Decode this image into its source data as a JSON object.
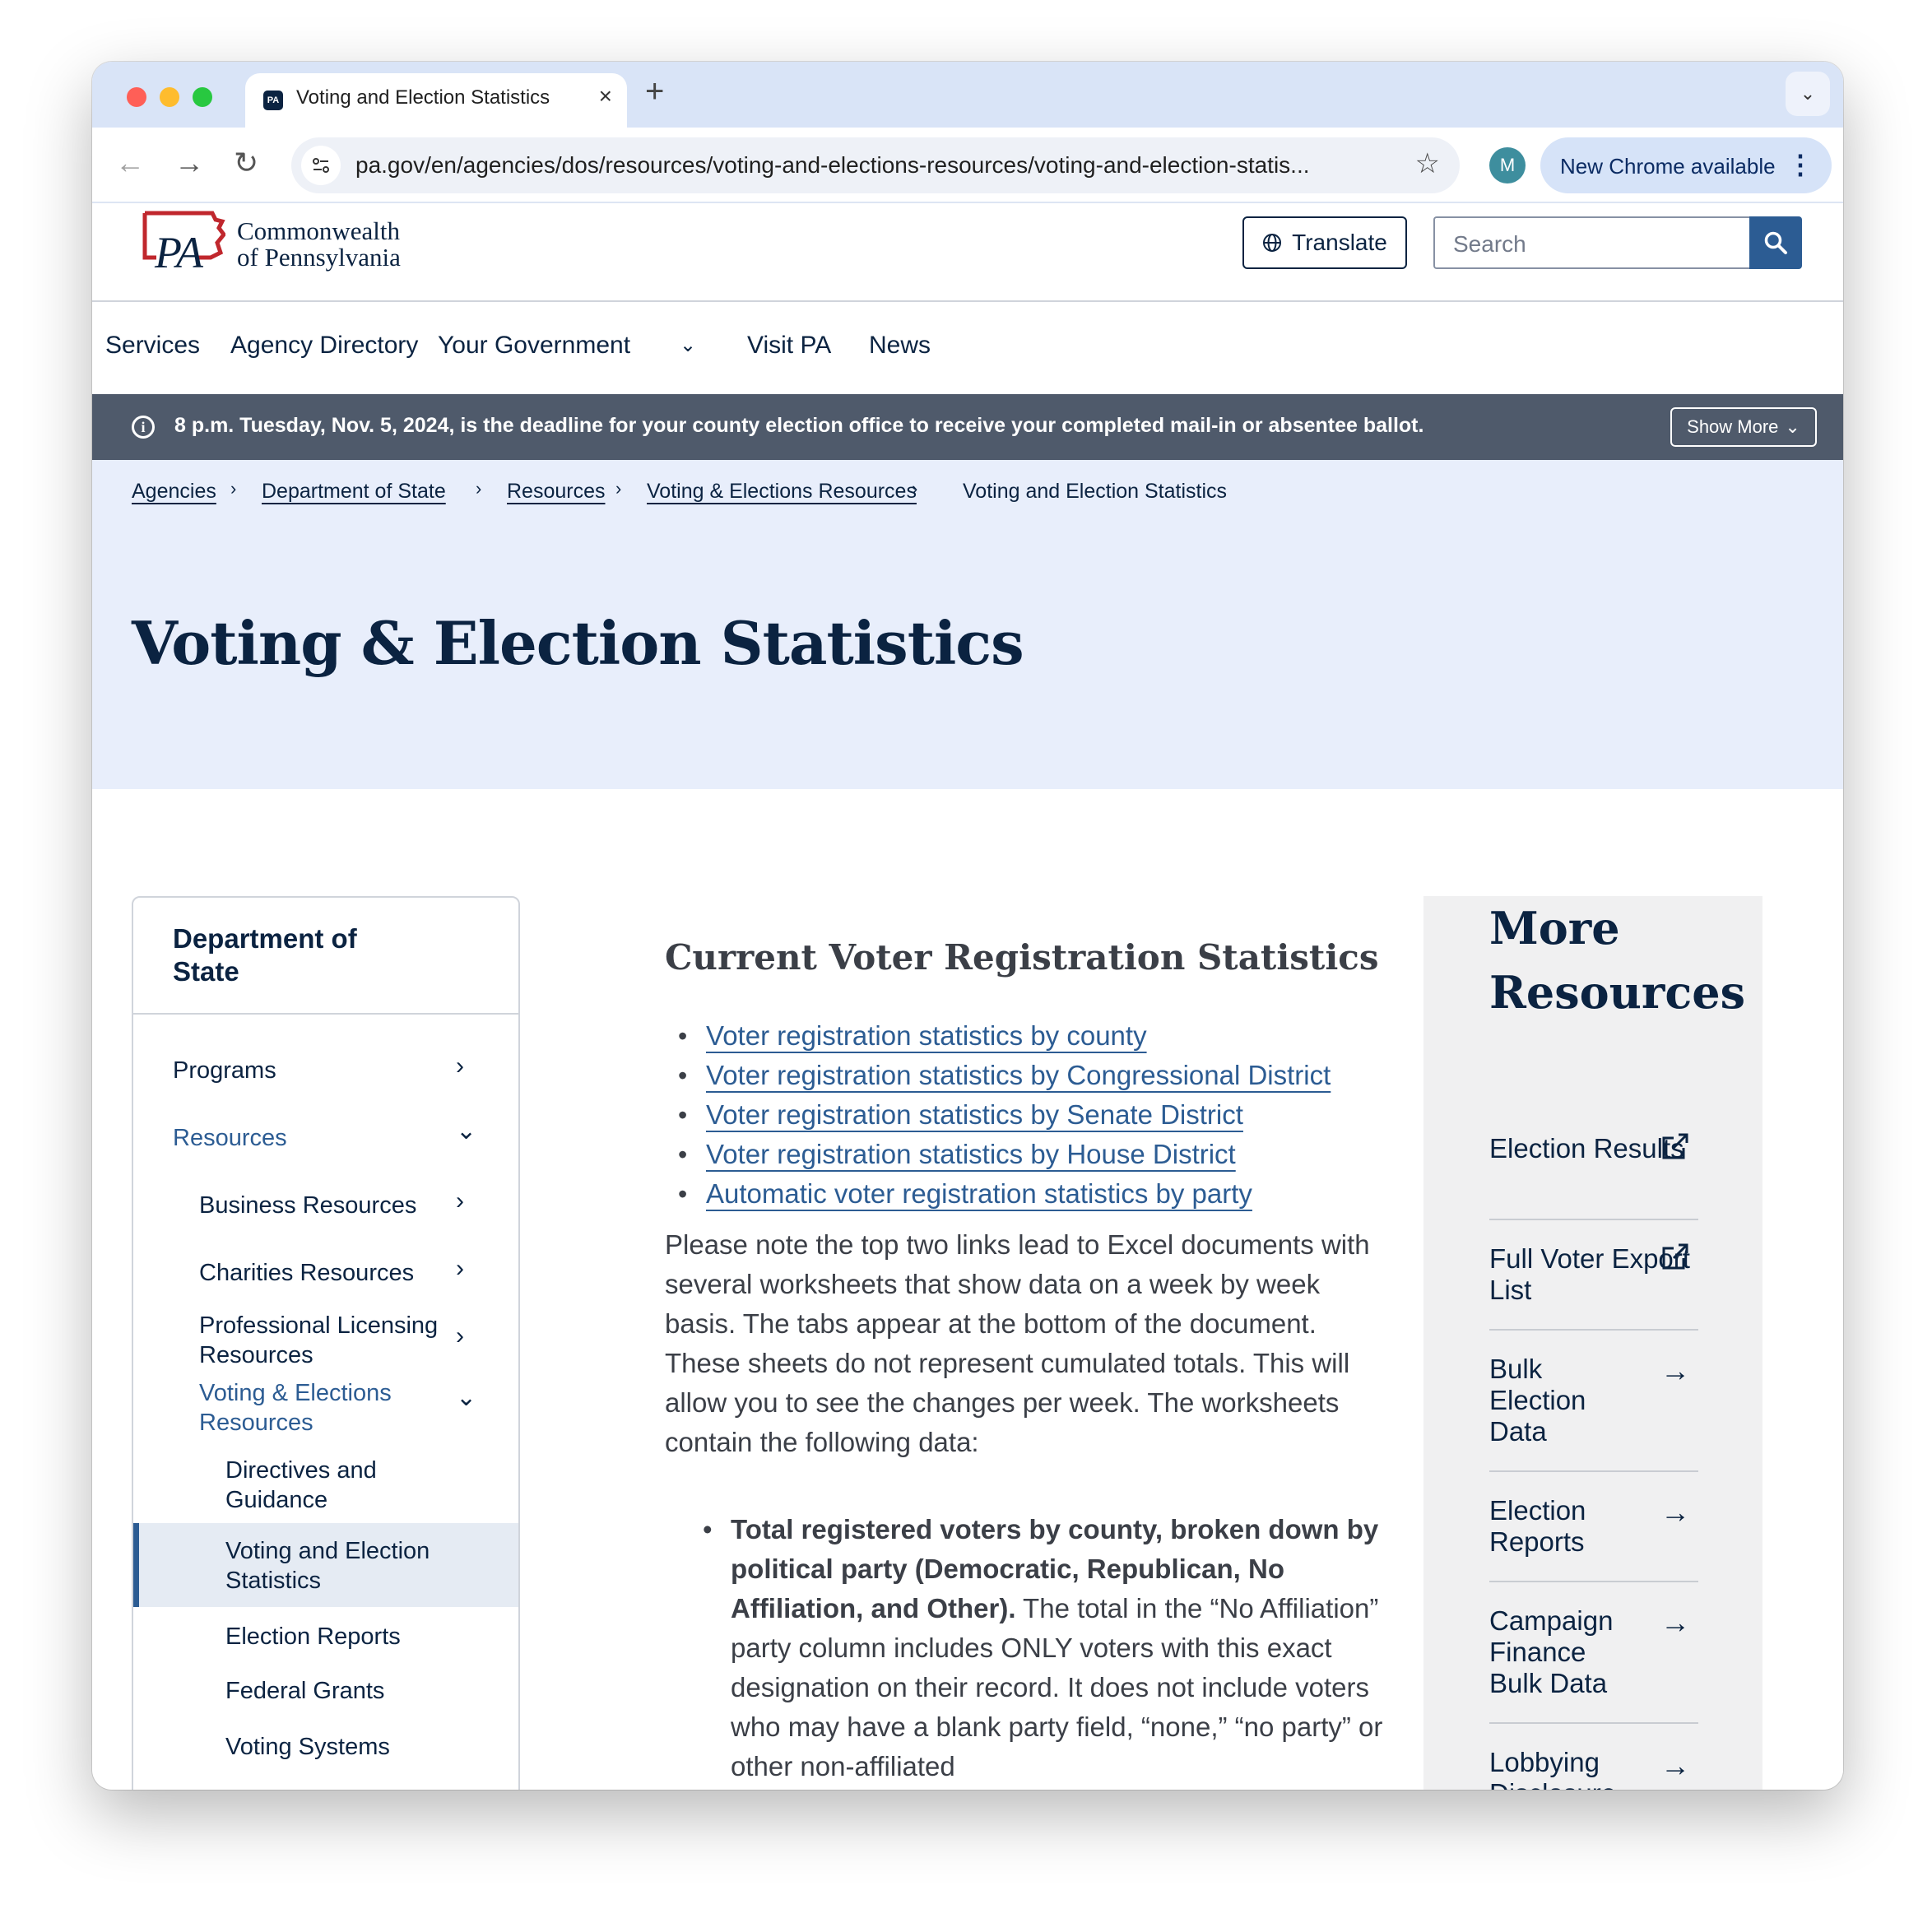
{
  "browser": {
    "tab_title": "Voting and Election Statistics",
    "favicon_text": "PA",
    "url": "pa.gov/en/agencies/dos/resources/voting-and-elections-resources/voting-and-election-statis...",
    "profile_initial": "M",
    "update_label": "New Chrome available"
  },
  "header": {
    "logo_line1": "Commonwealth",
    "logo_line2": "of Pennsylvania",
    "translate_label": "Translate",
    "search_placeholder": "Search"
  },
  "nav": {
    "items": [
      "Services",
      "Agency Directory",
      "Your Government",
      "Visit PA",
      "News"
    ]
  },
  "alert": {
    "text": "8 p.m. Tuesday, Nov. 5, 2024, is the deadline for your county election office to receive your completed mail-in or absentee ballot.",
    "show_more": "Show More"
  },
  "breadcrumb": {
    "items": [
      "Agencies",
      "Department of State",
      "Resources",
      "Voting & Elections Resources"
    ],
    "current": "Voting and Election Statistics"
  },
  "page_title": "Voting & Election Statistics",
  "sidebar": {
    "heading": "Department of State",
    "items": [
      "Programs",
      "Resources",
      "Business Resources",
      "Charities Resources",
      "Professional Licensing Resources",
      "Voting & Elections Resources",
      "Directives and Guidance",
      "Voting and Election Statistics",
      "Election Reports",
      "Federal Grants",
      "Voting Systems"
    ]
  },
  "content": {
    "section_title": "Current Voter Registration Statistics",
    "links": [
      "Voter registration statistics by county",
      "Voter registration statistics by Congressional District",
      "Voter registration statistics by Senate District",
      "Voter registration statistics by House District",
      "Automatic voter registration statistics by party"
    ],
    "paragraph": "Please note the top two links lead to Excel documents with several worksheets that show data on a week by week basis. The tabs appear at the bottom of the document.  These sheets do not represent cumulated totals. This will allow you to see the changes per week. The worksheets contain the following data:",
    "bullet_bold": "Total registered voters by county, broken down by political party (Democratic, Republican, No Affiliation, and Other).",
    "bullet_text": " The total in the “No Affiliation” party column includes ONLY voters with this exact designation on their record. It does not include voters who may have a blank party field, “none,” “no party” or other non-affiliated"
  },
  "more_resources": {
    "title": "More Resources",
    "items": [
      {
        "label": "Election Results",
        "icon": "external-link-icon"
      },
      {
        "label": "Full Voter Export List",
        "icon": "external-link-icon"
      },
      {
        "label": "Bulk Election Data",
        "icon": "arrow-right-icon"
      },
      {
        "label": "Election Reports",
        "icon": "arrow-right-icon"
      },
      {
        "label": "Campaign Finance Bulk Data",
        "icon": "arrow-right-icon"
      },
      {
        "label": "Lobbying Disclosure",
        "icon": "arrow-right-icon"
      }
    ]
  }
}
